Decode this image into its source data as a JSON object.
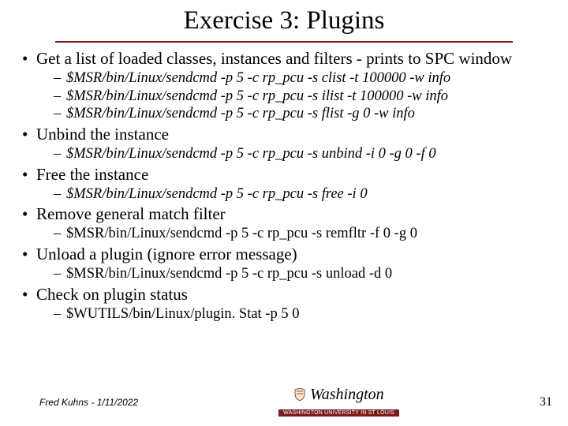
{
  "title": "Exercise 3: Plugins",
  "bullets": [
    {
      "text": "Get a list of loaded classes, instances and filters - prints to SPC window",
      "subs": [
        "$MSR/bin/Linux/sendcmd -p 5 -c rp_pcu -s clist -t 100000 -w info",
        "$MSR/bin/Linux/sendcmd -p 5 -c rp_pcu -s ilist -t 100000 -w info",
        "$MSR/bin/Linux/sendcmd -p 5 -c rp_pcu -s flist -g 0 -w info"
      ],
      "italic": true
    },
    {
      "text": "Unbind the instance",
      "subs": [
        "$MSR/bin/Linux/sendcmd -p 5 -c rp_pcu -s unbind -i 0 -g 0 -f 0"
      ],
      "italic": true
    },
    {
      "text": "Free the instance",
      "subs": [
        "$MSR/bin/Linux/sendcmd -p 5 -c rp_pcu -s free -i 0"
      ],
      "italic": true
    },
    {
      "text": "Remove general match filter",
      "subs": [
        "$MSR/bin/Linux/sendcmd -p 5 -c rp_pcu -s remfltr -f 0 -g 0"
      ],
      "italic": false
    },
    {
      "text": "Unload a plugin (ignore error message)",
      "subs": [
        "$MSR/bin/Linux/sendcmd -p 5 -c rp_pcu -s unload -d 0"
      ],
      "italic": false
    },
    {
      "text": "Check on plugin status",
      "subs": [
        "$WUTILS/bin/Linux/plugin. Stat -p 5 0"
      ],
      "italic": false
    }
  ],
  "footer": {
    "left": "Fred Kuhns - 1/11/2022",
    "center_main": "Washington",
    "center_sub": "WASHINGTON UNIVERSITY IN ST LOUIS",
    "page": "31"
  }
}
